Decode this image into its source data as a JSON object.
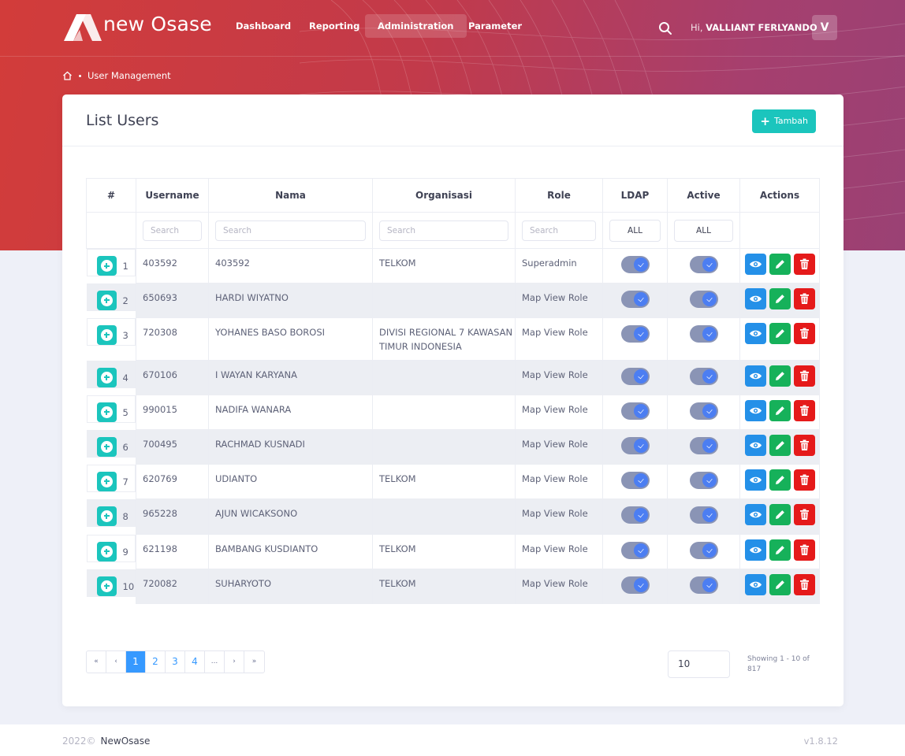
{
  "app": {
    "brand": "new Osase"
  },
  "nav": [
    {
      "label": "Dashboard"
    },
    {
      "label": "Reporting"
    },
    {
      "label": "Administration"
    },
    {
      "label": "Parameter"
    }
  ],
  "user": {
    "greeting": "Hi,",
    "name": "VALLIANT FERLYANDO",
    "initial": "V"
  },
  "breadcrumb": {
    "current": "User Management"
  },
  "card": {
    "title": "List Users",
    "add_label": "Tambah"
  },
  "table": {
    "headers": [
      "#",
      "Username",
      "Nama",
      "Organisasi",
      "Role",
      "LDAP",
      "Active",
      "Actions"
    ],
    "filters": {
      "username_placeholder": "Search",
      "nama_placeholder": "Search",
      "organisasi_placeholder": "Search",
      "role_placeholder": "Search",
      "ldap": "ALL",
      "active": "ALL"
    },
    "rows": [
      {
        "no": "1",
        "username": "403592",
        "nama": "403592",
        "organisasi": "TELKOM",
        "role": "Superadmin",
        "ldap": true,
        "active": true
      },
      {
        "no": "2",
        "username": "650693",
        "nama": "HARDI WIYATNO",
        "organisasi": "",
        "role": "Map View Role",
        "ldap": true,
        "active": true
      },
      {
        "no": "3",
        "username": "720308",
        "nama": "YOHANES BASO BOROSI",
        "organisasi": "DIVISI REGIONAL 7 KAWASAN TIMUR INDONESIA",
        "role": "Map View Role",
        "ldap": true,
        "active": true
      },
      {
        "no": "4",
        "username": "670106",
        "nama": "I WAYAN KARYANA",
        "organisasi": "",
        "role": "Map View Role",
        "ldap": true,
        "active": true
      },
      {
        "no": "5",
        "username": "990015",
        "nama": "NADIFA WANARA",
        "organisasi": "",
        "role": "Map View Role",
        "ldap": true,
        "active": true
      },
      {
        "no": "6",
        "username": "700495",
        "nama": "RACHMAD KUSNADI",
        "organisasi": "",
        "role": "Map View Role",
        "ldap": true,
        "active": true
      },
      {
        "no": "7",
        "username": "620769",
        "nama": "UDIANTO",
        "organisasi": "TELKOM",
        "role": "Map View Role",
        "ldap": true,
        "active": true
      },
      {
        "no": "8",
        "username": "965228",
        "nama": "AJUN WICAKSONO",
        "organisasi": "",
        "role": "Map View Role",
        "ldap": true,
        "active": true
      },
      {
        "no": "9",
        "username": "621198",
        "nama": "BAMBANG KUSDIANTO",
        "organisasi": "TELKOM",
        "role": "Map View Role",
        "ldap": true,
        "active": true
      },
      {
        "no": "10",
        "username": "720082",
        "nama": "SUHARYOTO",
        "organisasi": "TELKOM",
        "role": "Map View Role",
        "ldap": true,
        "active": true
      }
    ]
  },
  "pagination": {
    "first": "«",
    "prev": "‹",
    "pages": [
      "1",
      "2",
      "3",
      "4"
    ],
    "ellipsis": "...",
    "next": "›",
    "last": "»",
    "current": "1",
    "per_page": "10",
    "showing": "Showing 1 - 10 of 817"
  },
  "footer": {
    "year": "2022©",
    "name": "NewOsase",
    "version": "v1.8.12"
  },
  "colors": {
    "accent": "#1bc5bd",
    "primary": "#3699ff",
    "view": "#2490e8",
    "edit": "#16b15a",
    "delete": "#e51a1a"
  },
  "icons": [
    "search-icon",
    "home-icon",
    "plus-icon",
    "expand-icon",
    "eye-icon",
    "pencil-icon",
    "trash-icon"
  ]
}
